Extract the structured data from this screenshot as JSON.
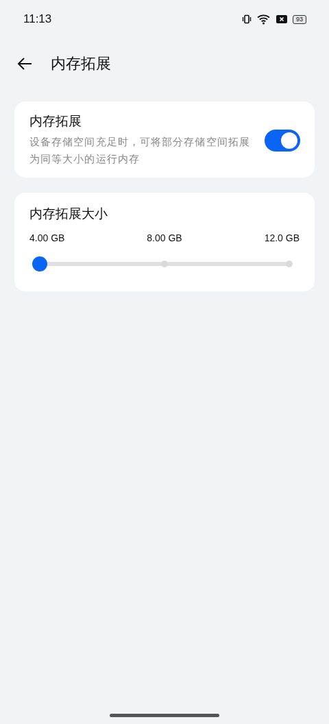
{
  "status_bar": {
    "time": "11:13",
    "battery": "93"
  },
  "header": {
    "title": "内存拓展"
  },
  "setting": {
    "title": "内存拓展",
    "description": "设备存储空间充足时，可将部分存储空间拓展为同等大小的运行内存",
    "on": true
  },
  "size": {
    "title": "内存拓展大小",
    "labels": [
      "4.00 GB",
      "8.00 GB",
      "12.0 GB"
    ],
    "level": 0
  }
}
